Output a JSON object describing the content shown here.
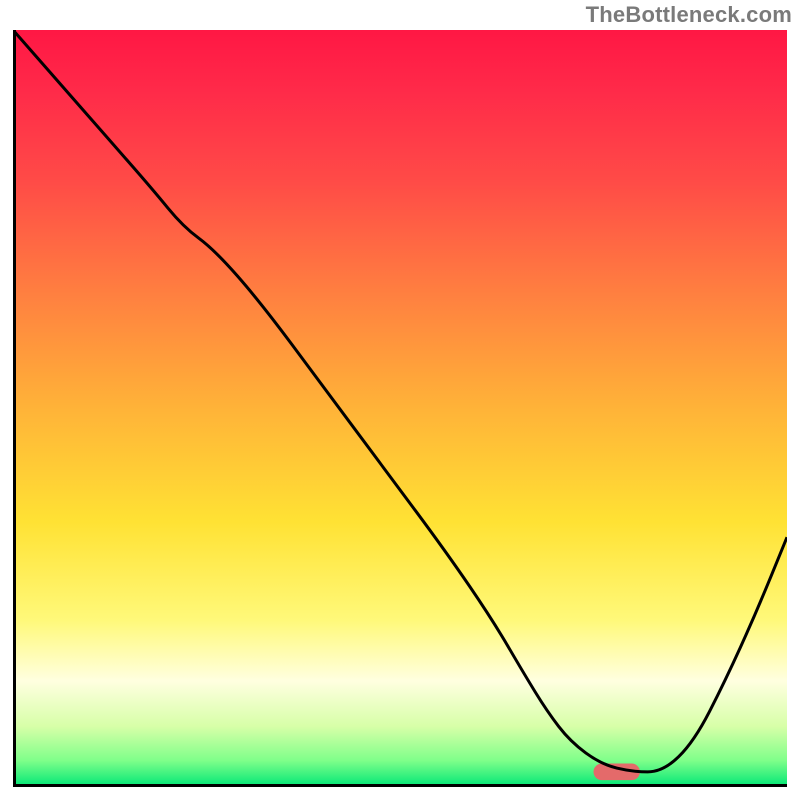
{
  "watermark": "TheBottleneck.com",
  "chart_data": {
    "type": "line",
    "title": "",
    "xlabel": "",
    "ylabel": "",
    "xlim": [
      0,
      100
    ],
    "ylim": [
      0,
      100
    ],
    "grid": false,
    "legend": false,
    "gradient_stops": [
      {
        "offset": 0.0,
        "color": "#ff1744"
      },
      {
        "offset": 0.08,
        "color": "#ff2a49"
      },
      {
        "offset": 0.2,
        "color": "#ff4b47"
      },
      {
        "offset": 0.35,
        "color": "#ff8040"
      },
      {
        "offset": 0.5,
        "color": "#ffb338"
      },
      {
        "offset": 0.65,
        "color": "#ffe234"
      },
      {
        "offset": 0.78,
        "color": "#fff97a"
      },
      {
        "offset": 0.86,
        "color": "#ffffe0"
      },
      {
        "offset": 0.92,
        "color": "#d7ffa8"
      },
      {
        "offset": 0.965,
        "color": "#7fff8a"
      },
      {
        "offset": 1.0,
        "color": "#00e676"
      }
    ],
    "series": [
      {
        "name": "curve",
        "color": "#000000",
        "x": [
          0,
          6,
          12,
          18,
          22,
          26,
          32,
          40,
          48,
          56,
          62,
          66,
          69,
          72,
          76,
          80,
          84,
          88,
          92,
          96,
          100
        ],
        "y": [
          100,
          93,
          86,
          79,
          74,
          71,
          64,
          53,
          42,
          31,
          22,
          15,
          10,
          6,
          3,
          2,
          2,
          6,
          14,
          23,
          33
        ]
      }
    ],
    "marker": {
      "name": "highlight-pill",
      "color": "#e46a6a",
      "x_center": 78,
      "y_center": 2,
      "width": 6,
      "height": 2.2,
      "rx": 1.1
    }
  }
}
